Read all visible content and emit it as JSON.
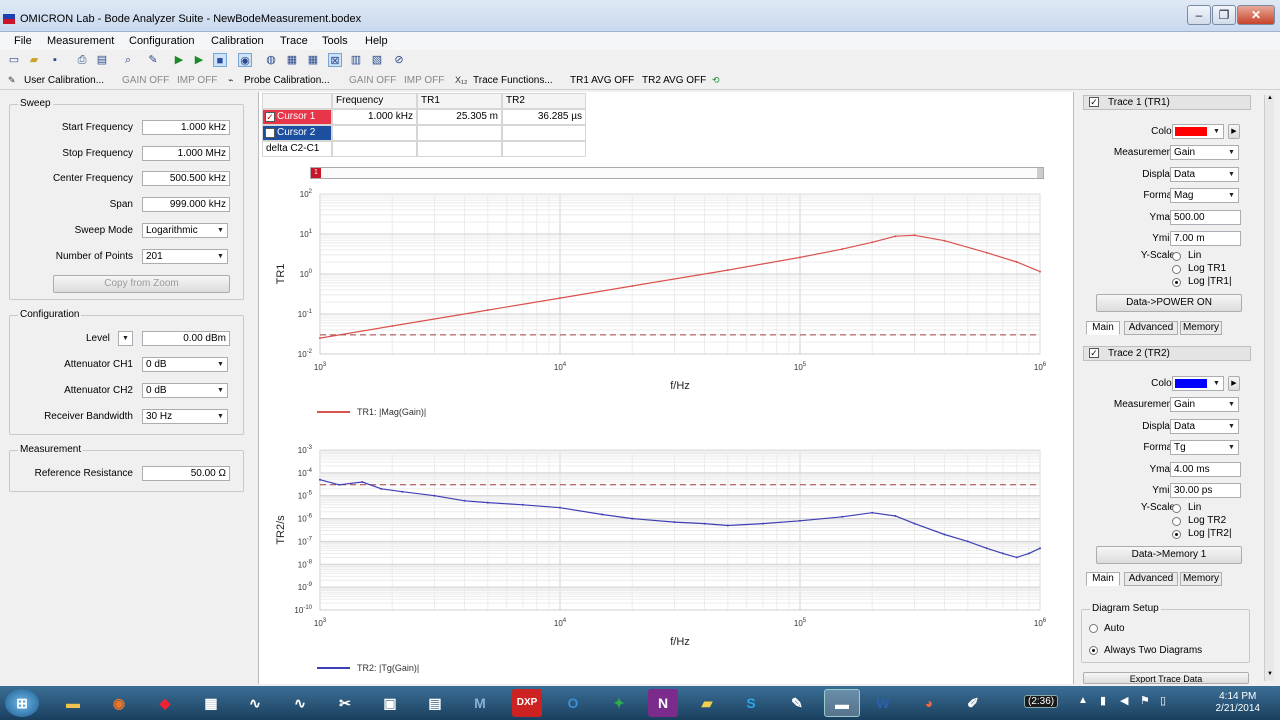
{
  "window": {
    "title": "OMICRON Lab - Bode Analyzer Suite - NewBodeMeasurement.bodex"
  },
  "menu": [
    "File",
    "Measurement",
    "Configuration",
    "Calibration",
    "Trace",
    "Tools",
    "Help"
  ],
  "toolbar2": {
    "user_cal": "User Calibration...",
    "gain_off_1": "GAIN OFF",
    "imp_off_1": "IMP OFF",
    "probe_cal": "Probe Calibration...",
    "gain_off_2": "GAIN OFF",
    "imp_off_2": "IMP OFF",
    "trace_functions": "Trace Functions...",
    "tr1_avg": "TR1 AVG OFF",
    "tr2_avg": "TR2 AVG OFF"
  },
  "sweep": {
    "title": "Sweep",
    "start_label": "Start Frequency",
    "start_value": "1.000 kHz",
    "stop_label": "Stop Frequency",
    "stop_value": "1.000 MHz",
    "center_label": "Center Frequency",
    "center_value": "500.500 kHz",
    "span_label": "Span",
    "span_value": "999.000 kHz",
    "mode_label": "Sweep Mode",
    "mode_value": "Logarithmic",
    "points_label": "Number of Points",
    "points_value": "201",
    "copy_zoom": "Copy from Zoom"
  },
  "configuration": {
    "title": "Configuration",
    "level_label": "Level",
    "level_value": "0.00 dBm",
    "att1_label": "Attenuator CH1",
    "att1_value": "0 dB",
    "att2_label": "Attenuator CH2",
    "att2_value": "0 dB",
    "rbw_label": "Receiver Bandwidth",
    "rbw_value": "30 Hz"
  },
  "measurement": {
    "title": "Measurement",
    "ref_label": "Reference Resistance",
    "ref_value": "50.00 Ω"
  },
  "cursor_table": {
    "headers": [
      "",
      "Frequency",
      "TR1",
      "TR2"
    ],
    "rows": [
      {
        "name": "Cursor 1",
        "freq": "1.000 kHz",
        "tr1": "25.305 m",
        "tr2": "36.285 µs"
      },
      {
        "name": "Cursor 2",
        "freq": "",
        "tr1": "",
        "tr2": ""
      },
      {
        "name": "delta C2-C1",
        "freq": "",
        "tr1": "",
        "tr2": ""
      }
    ],
    "cursor1_color": "#e8354a",
    "cursor2_color": "#1d4fa0"
  },
  "trace1": {
    "header": "Trace 1 (TR1)",
    "color_label": "Color",
    "color": "#ff0000",
    "measurement_label": "Measurement",
    "measurement": "Gain",
    "display_label": "Display",
    "display": "Data",
    "format_label": "Format",
    "format": "Mag",
    "ymax_label": "Ymax",
    "ymax": "500.00",
    "ymin_label": "Ymin",
    "ymin": "7.00 m",
    "yscale_label": "Y-Scale",
    "opt_lin": "Lin",
    "opt_log": "Log TR1",
    "opt_logabs": "Log |TR1|",
    "button": "Data->POWER ON",
    "tabs": [
      "Main",
      "Advanced",
      "Memory"
    ]
  },
  "trace2": {
    "header": "Trace 2 (TR2)",
    "color_label": "Color",
    "color": "#0000ff",
    "measurement_label": "Measurement",
    "measurement": "Gain",
    "display_label": "Display",
    "display": "Data",
    "format_label": "Format",
    "format": "Tg",
    "ymax_label": "Ymax",
    "ymax": "4.00 ms",
    "ymin_label": "Ymin",
    "ymin": "30.00 ps",
    "yscale_label": "Y-Scale",
    "opt_lin": "Lin",
    "opt_log": "Log TR2",
    "opt_logabs": "Log |TR2|",
    "button": "Data->Memory 1",
    "tabs": [
      "Main",
      "Advanced",
      "Memory"
    ]
  },
  "diagram_setup": {
    "title": "Diagram Setup",
    "auto": "Auto",
    "two": "Always Two Diagrams",
    "export": "Export Trace Data"
  },
  "chart_data": [
    {
      "type": "line",
      "ylabel": "TR1",
      "xlabel": "f/Hz",
      "x_ticks": [
        "10^3",
        "10^4",
        "10^5",
        "10^6"
      ],
      "y_ticks": [
        "10^2",
        "10^1",
        "10^0",
        "10^-1",
        "10^-2"
      ],
      "xlim": [
        1000,
        1000000
      ],
      "ylim": [
        0.01,
        100
      ],
      "xscale": "log",
      "yscale": "log",
      "grid": true,
      "series": [
        {
          "name": "TR1: |Mag(Gain)|",
          "color": "#d9534f",
          "x": [
            1000,
            2000,
            5000,
            10000,
            20000,
            50000,
            100000,
            150000,
            200000,
            250000,
            300000,
            400000,
            600000,
            800000,
            1000000
          ],
          "y": [
            0.025,
            0.05,
            0.125,
            0.25,
            0.5,
            1.25,
            2.6,
            4.2,
            6.2,
            8.8,
            9.3,
            6.8,
            3.4,
            2.0,
            1.15
          ]
        }
      ],
      "reference_line": {
        "y": 0.03,
        "style": "dashed"
      }
    },
    {
      "type": "line",
      "ylabel": "TR2/s",
      "xlabel": "f/Hz",
      "x_ticks": [
        "10^3",
        "10^4",
        "10^5",
        "10^6"
      ],
      "y_ticks": [
        "10^-3",
        "10^-4",
        "10^-5",
        "10^-6",
        "10^-7",
        "10^-8",
        "10^-9",
        "10^-10"
      ],
      "xlim": [
        1000,
        1000000
      ],
      "ylim": [
        1e-10,
        0.001
      ],
      "xscale": "log",
      "yscale": "log",
      "grid": true,
      "series": [
        {
          "name": "TR2: |Tg(Gain)|",
          "color": "#3f3fb5",
          "x": [
            1000,
            1200,
            1500,
            1800,
            2200,
            3000,
            4000,
            5000,
            7000,
            10000,
            15000,
            20000,
            30000,
            40000,
            50000,
            70000,
            100000,
            150000,
            200000,
            250000,
            300000,
            400000,
            500000,
            600000,
            700000,
            800000,
            900000,
            1000000
          ],
          "y": [
            5e-05,
            3e-05,
            4e-05,
            2e-05,
            1.5e-05,
            1e-05,
            6e-06,
            5e-06,
            4e-06,
            3e-06,
            1.5e-06,
            1e-06,
            7e-07,
            6e-07,
            5e-07,
            6e-07,
            8e-07,
            1.2e-06,
            1.8e-06,
            1.3e-06,
            6e-07,
            2e-07,
            1e-07,
            5e-08,
            3e-08,
            2e-08,
            3e-08,
            5e-08
          ]
        }
      ],
      "reference_line": {
        "y": 3e-05,
        "style": "dashed"
      }
    }
  ],
  "taskbar": {
    "time": "4:14 PM",
    "date": "2/21/2014",
    "timer": "(2:36)"
  }
}
